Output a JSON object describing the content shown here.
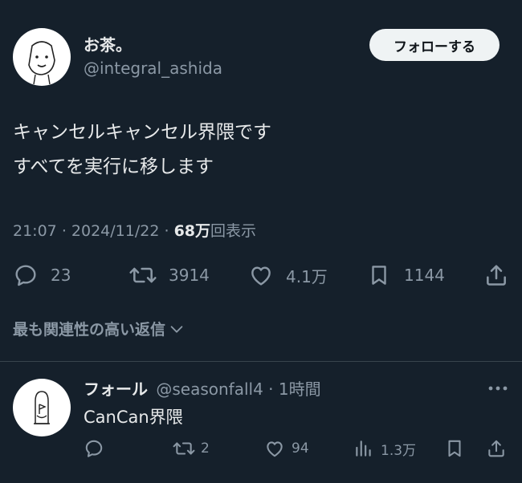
{
  "main_tweet": {
    "display_name": "お茶。",
    "handle": "@integral_ashida",
    "follow_label": "フォローする",
    "text_line1": "キャンセルキャンセル界隈です",
    "text_line2": "すべてを実行に移します",
    "time": "21:07",
    "sep1": "·",
    "date": "2024/11/22",
    "sep2": "·",
    "views_count": "68万",
    "views_label": "回表示",
    "replies": "23",
    "retweets": "3914",
    "likes": "4.1万",
    "bookmarks": "1144",
    "icons": [
      "reply-icon",
      "retweet-icon",
      "like-icon",
      "bookmark-icon",
      "share-icon"
    ]
  },
  "replies_filter": {
    "label": "最も関連性の高い返信",
    "icon": "chevron-down-icon"
  },
  "reply_tweet": {
    "display_name": "フォール",
    "handle": "@seasonfall4",
    "sep": "·",
    "time_ago": "1時間",
    "more_icon": "more-icon",
    "text": "CanCan界隈",
    "replies": "",
    "retweets": "2",
    "likes": "94",
    "views": "1.3万",
    "icons": [
      "reply-icon",
      "retweet-icon",
      "like-icon",
      "views-icon",
      "bookmark-icon",
      "share-icon"
    ]
  },
  "colors": {
    "background": "#15202b",
    "text": "#e7e9ea",
    "muted": "#8b98a5",
    "divider": "#38444d",
    "button_bg": "#eff3f4"
  }
}
